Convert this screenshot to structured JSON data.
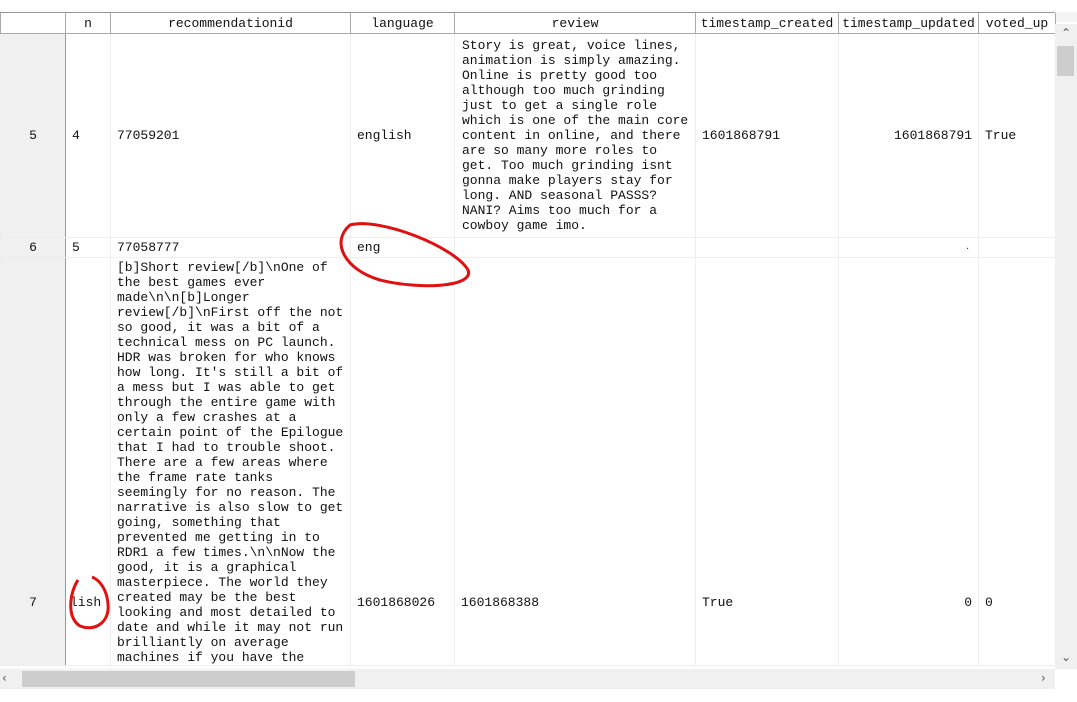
{
  "columns": [
    "",
    "n",
    "recommendationid",
    "language",
    "review",
    "timestamp_created",
    "timestamp_updated",
    "voted_up"
  ],
  "rows": [
    {
      "index": "5",
      "n": "4",
      "recommendationid": "77059201",
      "language": "english",
      "review": "Story is great, voice lines, animation is simply amazing. Online is pretty good too although too much grinding just to get a single role which is one of the main core content in online, and there are so many more roles to get. Too much grinding isnt gonna make players stay for long. AND seasonal PASSS? NANI? Aims too much for a cowboy game imo.",
      "timestamp_created": "1601868791",
      "timestamp_updated": "1601868791",
      "voted_up": "True"
    },
    {
      "index": "6",
      "n": "5",
      "recommendationid": "77058777",
      "language": "eng",
      "review": "",
      "timestamp_created": "",
      "timestamp_updated": ".",
      "voted_up": ""
    },
    {
      "index": "7",
      "n": "lish",
      "recommendationid": "[b]Short review[/b]\\nOne of the best games ever made\\n\\n[b]Longer review[/b]\\nFirst off the not so good, it was a bit of a technical mess on PC launch. HDR was broken for who knows how long.  It's still a bit of a mess but I was able to get through the entire game with only a few crashes at a certain point of the Epilogue that I had to trouble shoot. There are a few areas where the frame rate tanks seemingly for no reason.  The narrative is also slow to get going, something that prevented me getting in to RDR1 a few times.\\n\\nNow the good, it is a graphical masterpiece.  The world they created may be the best looking and most detailed to date and while it may not run brilliantly on average machines if you have the",
      "language": "1601868026",
      "review": "1601868388",
      "timestamp_created": "True",
      "timestamp_updated": "0",
      "voted_up": "0"
    }
  ],
  "colors": {
    "annotation": "#e01010",
    "header_border": "#aaaaaa",
    "scroll_thumb": "#cdcdcd"
  }
}
